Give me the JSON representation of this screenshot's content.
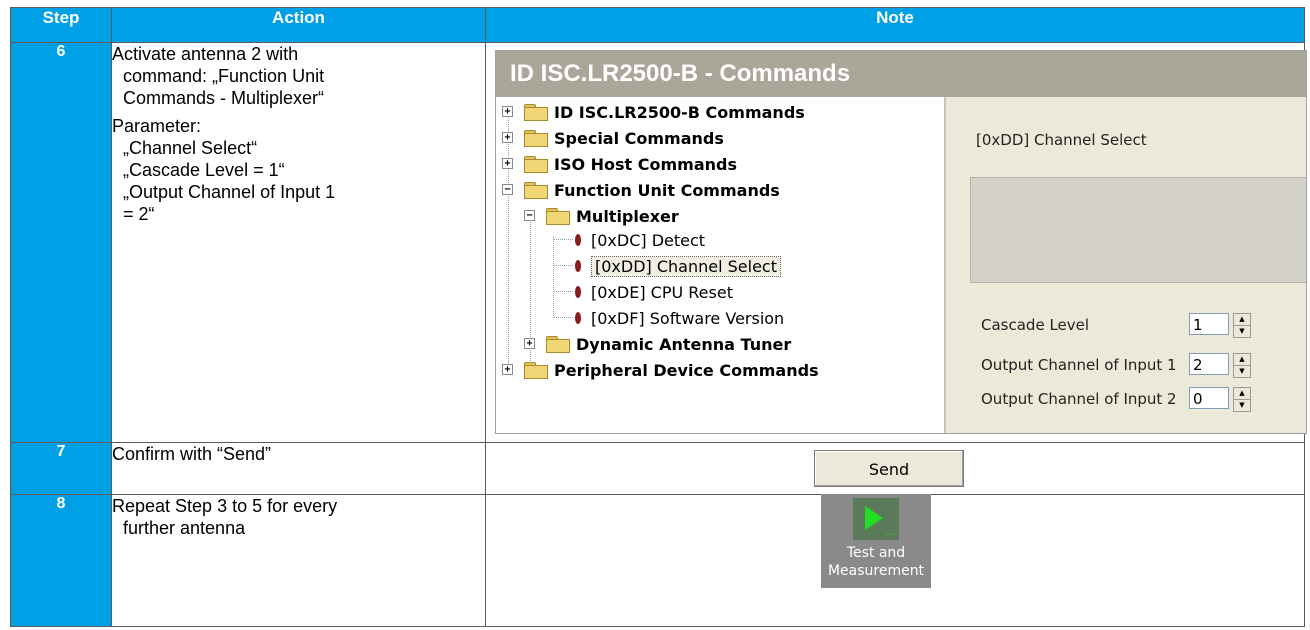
{
  "header": {
    "step": "Step",
    "action": "Action",
    "note": "Note"
  },
  "rows": [
    {
      "step": "6",
      "action_lines": [
        "Activate antenna 2 with",
        "command: „Function Unit",
        "Commands -  Multiplexer“"
      ],
      "param_label": "Parameter:",
      "param_lines": [
        "„Channel Select“",
        "„Cascade Level = 1“",
        "„Output Channel of Input 1",
        "= 2“"
      ]
    },
    {
      "step": "7",
      "action": "Confirm with “Send”"
    },
    {
      "step": "8",
      "action_lines": [
        "Repeat Step 3 to 5 for every",
        "further antenna"
      ]
    }
  ],
  "window": {
    "title": "ID ISC.LR2500-B - Commands",
    "tree": {
      "top_nodes": [
        "ID ISC.LR2500-B Commands",
        "Special Commands",
        "ISO Host Commands",
        "Function Unit Commands"
      ],
      "multiplexer": "Multiplexer",
      "leaves": [
        "[0xDC] Detect",
        "[0xDD] Channel Select",
        "[0xDE] CPU Reset",
        "[0xDF] Software Version"
      ],
      "dynamic": "Dynamic Antenna Tuner",
      "peripheral": "Peripheral Device Commands"
    },
    "panel": {
      "selected": "[0xDD] Channel Select",
      "fields": [
        {
          "label": "Cascade Level",
          "value": "1"
        },
        {
          "label": "Output Channel of Input 1",
          "value": "2"
        },
        {
          "label": "Output Channel of Input 2",
          "value": "0"
        }
      ]
    }
  },
  "send_button": {
    "label": "Send"
  },
  "test_tile": {
    "line1": "Test and",
    "line2": "Measurement",
    "icon": "play-icon"
  }
}
